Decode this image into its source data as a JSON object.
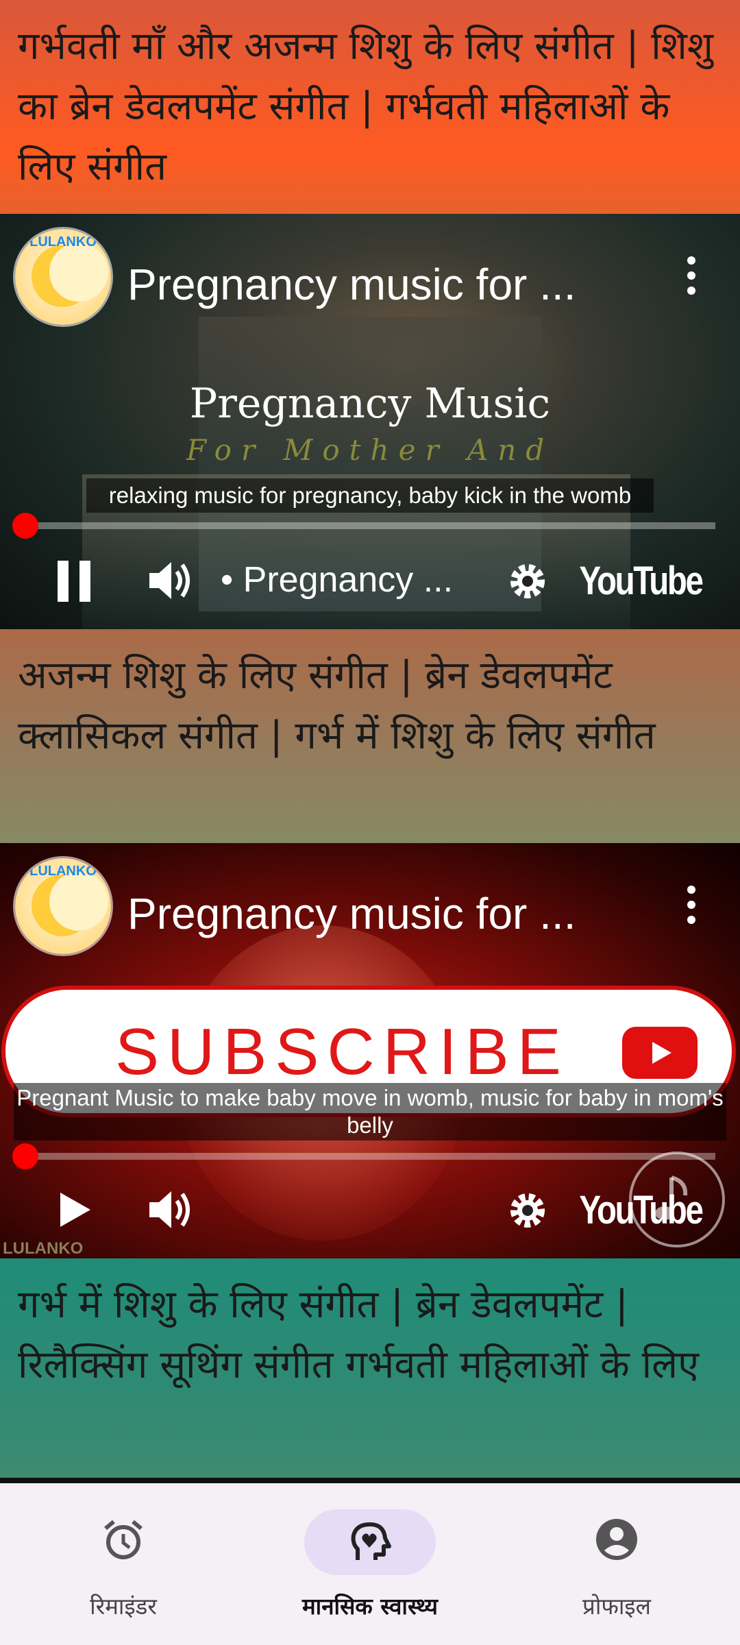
{
  "sections": [
    {
      "title": "गर्भवती माँ और अजन्म शिशु के लिए संगीत | शिशु का ब्रेन डेवलपमेंट संगीत | गर्भवती महिलाओं के लिए संगीत",
      "bg_from": "#c8523a",
      "bg_to": "#ff5a22"
    },
    {
      "title": "अजन्म शिशु के लिए संगीत | ब्रेन डेवलपमेंट क्लासिकल संगीत | गर्भ में शिशु के लिए संगीत",
      "bg_from": "#a86a4a",
      "bg_to": "#8c8762"
    },
    {
      "title": "गर्भ में शिशु के लिए संगीत | ब्रेन डेवलपमेंट | रिलैक्सिंग सूथिंग संगीत गर्भवती महिलाओं के लिए",
      "bg_from": "#1f8c78",
      "bg_to": "#3b8b72"
    }
  ],
  "videos": [
    {
      "channel_logo": "LULANKO",
      "title": "Pregnancy music for ...",
      "overlay_title": "Pregnancy Music",
      "overlay_subtitle": "For Mother And",
      "caption": "relaxing music for pregnancy, baby kick in the womb",
      "chapter": "• Pregnancy ...",
      "play_state": "playing",
      "progress": 0.0,
      "brand": "YouTube",
      "watermark": "LULANKO"
    },
    {
      "channel_logo": "LULANKO",
      "title": "Pregnancy music for ...",
      "banner": "SUBSCRIBE",
      "caption": "Pregnant Music to make baby move in womb, music for baby in mom's belly",
      "play_state": "paused",
      "progress": 0.0,
      "brand": "YouTube",
      "watermark": "LULANKO"
    }
  ],
  "nav": {
    "items": [
      {
        "label": "रिमाइंडर",
        "icon": "alarm-clock-icon",
        "active": false
      },
      {
        "label": "मानसिक स्वास्थ्य",
        "icon": "mental-health-icon",
        "active": true
      },
      {
        "label": "प्रोफाइल",
        "icon": "account-circle-icon",
        "active": false
      }
    ]
  },
  "colors": {
    "accent_red": "#ff0000",
    "nav_pill": "#e7dcf6",
    "nav_bg": "#f5f0f6"
  }
}
